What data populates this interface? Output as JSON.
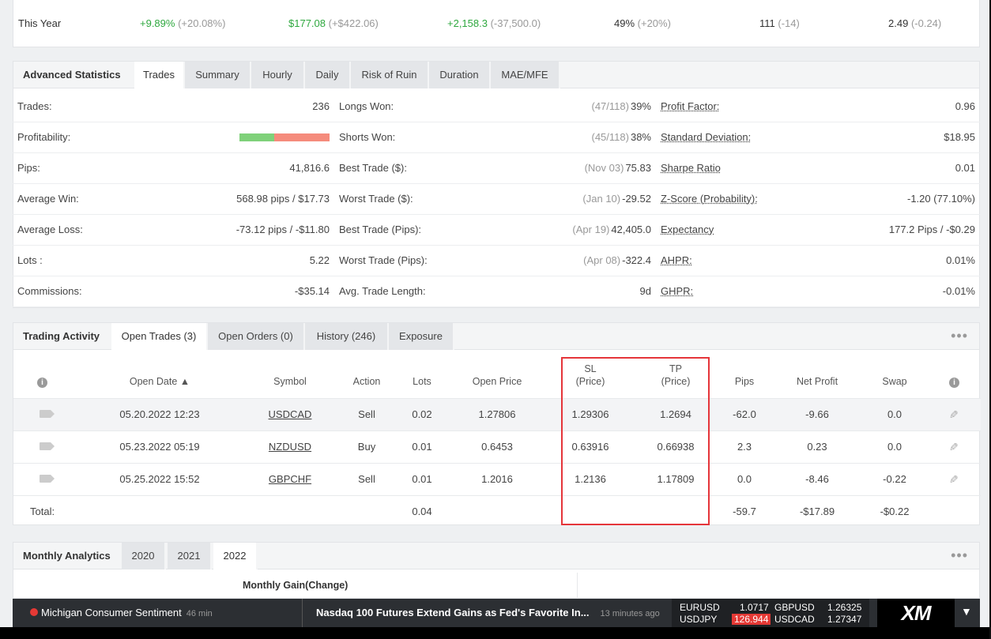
{
  "top_row": {
    "label": "This Year",
    "gain": "+9.89%",
    "gain_change": "(+20.08%)",
    "profit": "$177.08",
    "profit_change": "(+$422.06)",
    "pips": "+2,158.3",
    "pips_change": "(-37,500.0)",
    "won": "49%",
    "won_change": "(+20%)",
    "trades": "111",
    "trades_change": "(-14)",
    "lots": "2.49",
    "lots_change": "(-0.24)"
  },
  "advanced": {
    "title": "Advanced Statistics",
    "tabs": [
      "Trades",
      "Summary",
      "Hourly",
      "Daily",
      "Risk of Ruin",
      "Duration",
      "MAE/MFE"
    ],
    "col1": [
      {
        "label": "Trades:",
        "value": "236"
      },
      {
        "label": "Profitability:",
        "value": ""
      },
      {
        "label": "Pips:",
        "value": "41,816.6"
      },
      {
        "label": "Average Win:",
        "value": "568.98 pips / $17.73"
      },
      {
        "label": "Average Loss:",
        "value": "-73.12 pips / -$11.80"
      },
      {
        "label": "Lots :",
        "value": "5.22"
      },
      {
        "label": "Commissions:",
        "value": "-$35.14"
      }
    ],
    "col2": [
      {
        "label": "Longs Won:",
        "muted": "(47/118)",
        "value": "39%"
      },
      {
        "label": "Shorts Won:",
        "muted": "(45/118)",
        "value": "38%"
      },
      {
        "label": "Best Trade ($):",
        "muted": "(Nov 03)",
        "value": "75.83"
      },
      {
        "label": "Worst Trade ($):",
        "muted": "(Jan 10)",
        "value": "-29.52"
      },
      {
        "label": "Best Trade (Pips):",
        "muted": "(Apr 19)",
        "value": "42,405.0"
      },
      {
        "label": "Worst Trade (Pips):",
        "muted": "(Apr 08)",
        "value": "-322.4"
      },
      {
        "label": "Avg. Trade Length:",
        "muted": "",
        "value": "9d"
      }
    ],
    "col3": [
      {
        "label": "Profit Factor:",
        "value": "0.96"
      },
      {
        "label": "Standard Deviation:",
        "value": "$18.95"
      },
      {
        "label": "Sharpe Ratio",
        "value": "0.01"
      },
      {
        "label": "Z-Score (Probability):",
        "value": "-1.20 (77.10%)"
      },
      {
        "label": "Expectancy",
        "value": "177.2 Pips / -$0.29"
      },
      {
        "label": "AHPR:",
        "value": "0.01%"
      },
      {
        "label": "GHPR:",
        "value": "-0.01%"
      }
    ],
    "profitability_win_fraction": 0.39
  },
  "activity": {
    "title": "Trading Activity",
    "tabs": [
      "Open Trades (3)",
      "Open Orders (0)",
      "History (246)",
      "Exposure"
    ],
    "headers": {
      "open_date": "Open Date ▲",
      "symbol": "Symbol",
      "action": "Action",
      "lots": "Lots",
      "open_price": "Open Price",
      "sl1": "SL",
      "sl2": "(Price)",
      "tp1": "TP",
      "tp2": "(Price)",
      "pips": "Pips",
      "net_profit": "Net Profit",
      "swap": "Swap"
    },
    "rows": [
      {
        "date": "05.20.2022 12:23",
        "symbol": "USDCAD",
        "action": "Sell",
        "lots": "0.02",
        "open": "1.27806",
        "sl": "1.29306",
        "tp": "1.2694",
        "pips": "-62.0",
        "profit": "-9.66",
        "swap": "0.0"
      },
      {
        "date": "05.23.2022 05:19",
        "symbol": "NZDUSD",
        "action": "Buy",
        "lots": "0.01",
        "open": "0.6453",
        "sl": "0.63916",
        "tp": "0.66938",
        "pips": "2.3",
        "profit": "0.23",
        "swap": "0.0"
      },
      {
        "date": "05.25.2022 15:52",
        "symbol": "GBPCHF",
        "action": "Sell",
        "lots": "0.01",
        "open": "1.2016",
        "sl": "1.2136",
        "tp": "1.17809",
        "pips": "0.0",
        "profit": "-8.46",
        "swap": "-0.22"
      }
    ],
    "total": {
      "label": "Total:",
      "lots": "0.04",
      "pips": "-59.7",
      "profit": "-$17.89",
      "swap": "-$0.22"
    }
  },
  "monthly": {
    "title": "Monthly Analytics",
    "tabs": [
      "2020",
      "2021",
      "2022"
    ],
    "subheader": "Monthly Gain(Change)"
  },
  "ticker": {
    "event": "Michigan Consumer Sentiment",
    "event_age": "46 min",
    "headline": "Nasdaq 100 Futures Extend Gains as Fed's Favorite In...",
    "headline_age": "13 minutes ago",
    "quotes": [
      {
        "symbol": "EURUSD",
        "price": "1.0717"
      },
      {
        "symbol": "GBPUSD",
        "price": "1.26325"
      },
      {
        "symbol": "USDJPY",
        "price": "126.944"
      },
      {
        "symbol": "USDCAD",
        "price": "1.27347"
      }
    ],
    "logo": "XM"
  },
  "colors": {
    "positive": "#2fa83f",
    "negative": "#e0463a",
    "highlight_box": "#e5353a"
  }
}
